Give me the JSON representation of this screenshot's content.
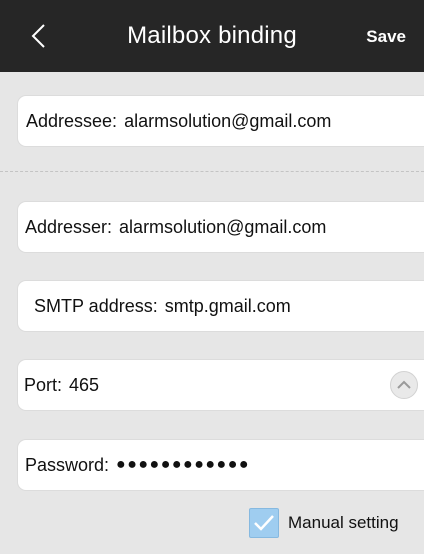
{
  "header": {
    "title": "Mailbox binding",
    "save_label": "Save",
    "back_icon": "chevron-left-icon",
    "background": "#262626"
  },
  "form": {
    "addressee": {
      "label": "Addressee:",
      "value": "alarmsolution@gmail.com"
    },
    "addresser": {
      "label": "Addresser:",
      "value": "alarmsolution@gmail.com"
    },
    "smtp": {
      "label": "SMTP address:",
      "value": "smtp.gmail.com"
    },
    "port": {
      "label": "Port:",
      "value": "465",
      "toggle_icon": "chevron-up-icon"
    },
    "password": {
      "label": "Password:",
      "value": "●●●●●●●●●●●●"
    }
  },
  "manual_setting": {
    "label": "Manual setting",
    "checked": true,
    "check_color": "#9fcdf0"
  }
}
